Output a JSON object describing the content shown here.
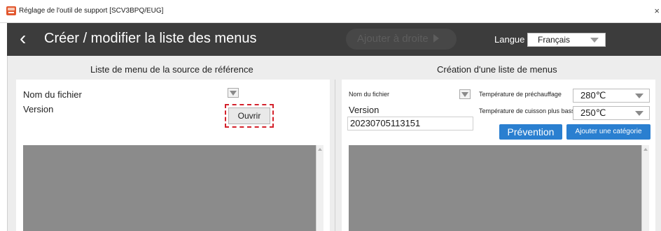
{
  "window": {
    "title": "Réglage de l'outil de support [SCV3BPQ/EUG]",
    "close_glyph": "×"
  },
  "header": {
    "back_glyph": "‹",
    "title": "Créer / modifier la liste des menus",
    "add_right_label": "Ajouter à droite",
    "language_label": "Langue",
    "language_value": "Français"
  },
  "left_panel": {
    "section_title": "Liste de menu de la source de référence",
    "filename_label": "Nom du fichier",
    "version_label": "Version",
    "open_button": "Ouvrir"
  },
  "right_panel": {
    "section_title": "Création d'une liste de menus",
    "filename_label": "Nom du fichier",
    "version_label": "Version",
    "version_value": "20230705113151",
    "preheat_label": "Température de préchauffage",
    "preheat_value": "280℃",
    "min_cook_label": "Température de cuisson plus basse",
    "min_cook_value": "250℃",
    "prevention_button": "Prévention",
    "add_category_button": "Ajouter une catégorie"
  },
  "colors": {
    "header_bg": "#3c3c3c",
    "accent_blue": "#2a7fd0",
    "highlight_red": "#d4212b",
    "list_grey": "#8b8b8b"
  }
}
